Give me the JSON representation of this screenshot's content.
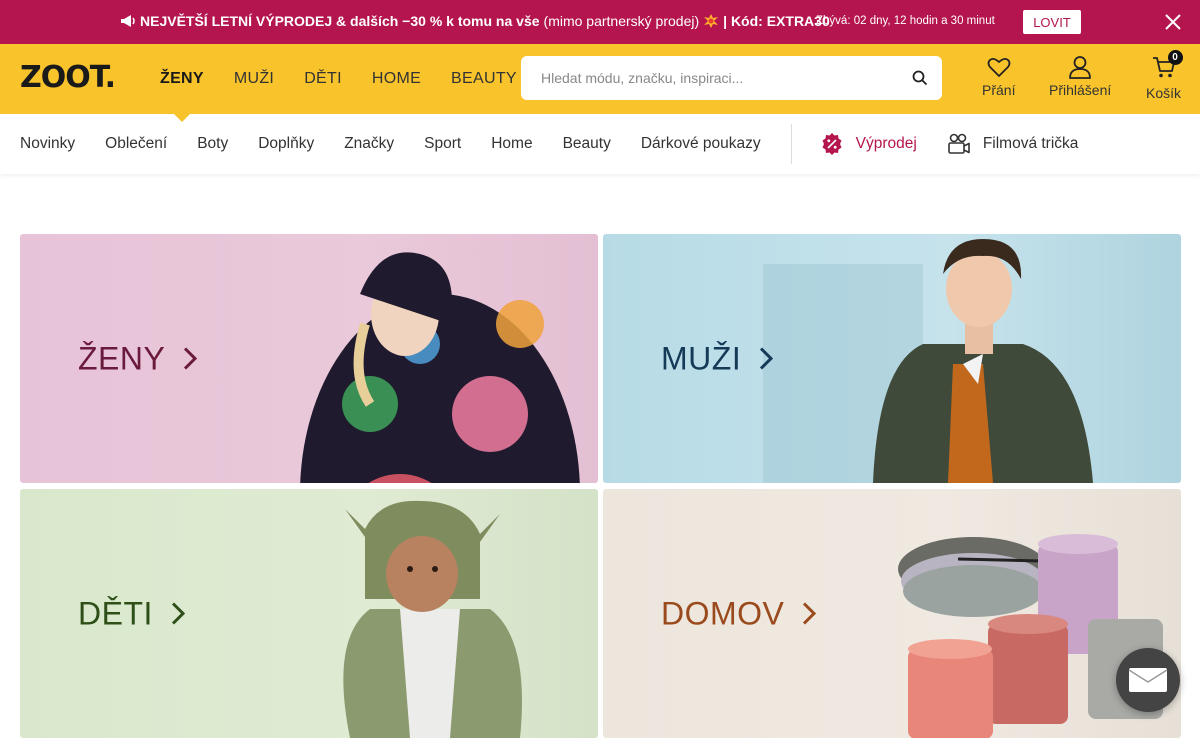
{
  "promo": {
    "icon": "megaphone-icon",
    "headline": "NEJVĚTŠÍ LETNÍ VÝPRODEJ & dalších −30 % k tomu na vše",
    "note": "(mimo partnerský prodej)",
    "code_text": "| Kód: EXTRA30",
    "timer": "Zbývá: 02 dny, 12 hodin a 30 minut",
    "button": "LOVIT",
    "bg_color": "#b5154e"
  },
  "header": {
    "logo": "ZOOT.",
    "bg_color": "#f9c32b",
    "nav": [
      {
        "label": "ŽENY",
        "active": true
      },
      {
        "label": "MUŽI"
      },
      {
        "label": "DĚTI"
      },
      {
        "label": "HOME"
      },
      {
        "label": "BEAUTY"
      }
    ],
    "search_placeholder": "Hledat módu, značku, inspiraci...",
    "wishlist": "Přání",
    "login": "Přihlášení",
    "cart": "Košík",
    "cart_count": "0"
  },
  "subnav": {
    "items": [
      "Novinky",
      "Oblečení",
      "Boty",
      "Doplňky",
      "Značky",
      "Sport",
      "Home",
      "Beauty",
      "Dárkové poukazy"
    ],
    "sale": "Výprodej",
    "film": "Filmová trička"
  },
  "tiles": [
    {
      "label": "ŽENY",
      "color": "#6a1a3d"
    },
    {
      "label": "MUŽI",
      "color": "#143a58"
    },
    {
      "label": "DĚTI",
      "color": "#2e4f18"
    },
    {
      "label": "DOMOV",
      "color": "#9a4a1c"
    }
  ]
}
